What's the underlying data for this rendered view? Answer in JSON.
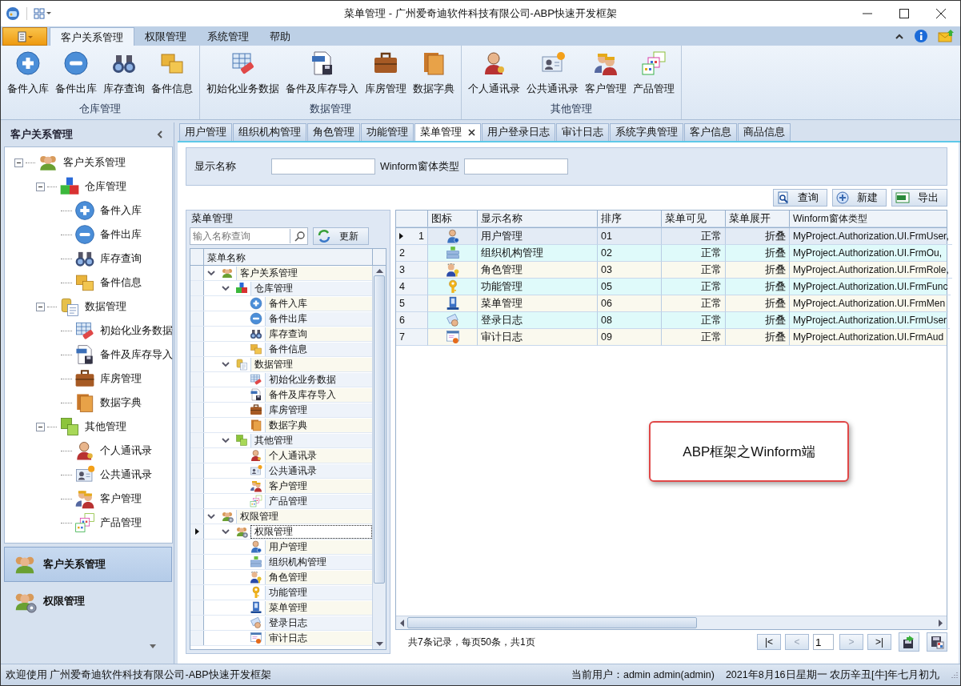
{
  "window": {
    "title": "菜单管理 - 广州爱奇迪软件科技有限公司-ABP快速开发框架"
  },
  "ribbon": {
    "tabs": [
      {
        "label": "客户关系管理",
        "selected": true
      },
      {
        "label": "权限管理",
        "selected": false
      },
      {
        "label": "系统管理",
        "selected": false
      },
      {
        "label": "帮助",
        "selected": false
      }
    ],
    "groups": [
      {
        "label": "仓库管理",
        "buttons": [
          "备件入库",
          "备件出库",
          "库存查询",
          "备件信息"
        ]
      },
      {
        "label": "数据管理",
        "buttons": [
          "初始化业务数据",
          "备件及库存导入",
          "库房管理",
          "数据字典"
        ]
      },
      {
        "label": "其他管理",
        "buttons": [
          "个人通讯录",
          "公共通讯录",
          "客户管理",
          "产品管理"
        ]
      }
    ]
  },
  "nav": {
    "title": "客户关系管理",
    "tree": [
      {
        "label": "客户关系管理",
        "expanded": true,
        "children": [
          {
            "label": "仓库管理",
            "expanded": true,
            "children": [
              {
                "label": "备件入库"
              },
              {
                "label": "备件出库"
              },
              {
                "label": "库存查询"
              },
              {
                "label": "备件信息"
              }
            ]
          },
          {
            "label": "数据管理",
            "expanded": true,
            "children": [
              {
                "label": "初始化业务数据"
              },
              {
                "label": "备件及库存导入"
              },
              {
                "label": "库房管理"
              },
              {
                "label": "数据字典"
              }
            ]
          },
          {
            "label": "其他管理",
            "expanded": true,
            "children": [
              {
                "label": "个人通讯录"
              },
              {
                "label": "公共通讯录"
              },
              {
                "label": "客户管理"
              },
              {
                "label": "产品管理"
              }
            ]
          }
        ]
      }
    ],
    "panes": [
      {
        "label": "客户关系管理",
        "selected": true
      },
      {
        "label": "权限管理",
        "selected": false
      }
    ]
  },
  "doc_tabs": [
    {
      "label": "用户管理",
      "selected": false
    },
    {
      "label": "组织机构管理",
      "selected": false
    },
    {
      "label": "角色管理",
      "selected": false
    },
    {
      "label": "功能管理",
      "selected": false
    },
    {
      "label": "菜单管理",
      "selected": true
    },
    {
      "label": "用户登录日志",
      "selected": false
    },
    {
      "label": "审计日志",
      "selected": false
    },
    {
      "label": "系统字典管理",
      "selected": false
    },
    {
      "label": "客户信息",
      "selected": false
    },
    {
      "label": "商品信息",
      "selected": false
    }
  ],
  "search_fields": [
    {
      "label": "显示名称"
    },
    {
      "label": "Winform窗体类型"
    }
  ],
  "actions": [
    "查询",
    "新建",
    "导出"
  ],
  "menu_tree": {
    "title": "菜单管理",
    "search": {
      "placeholder": "输入名称查询"
    },
    "refresh": "更新",
    "column": "菜单名称",
    "rows": [
      {
        "label": "客户关系管理",
        "selected": false,
        "expanded": true,
        "children": [
          {
            "label": "仓库管理",
            "selected": false,
            "expanded": true,
            "children": [
              {
                "label": "备件入库",
                "selected": false
              },
              {
                "label": "备件出库",
                "selected": false
              },
              {
                "label": "库存查询",
                "selected": false
              },
              {
                "label": "备件信息",
                "selected": false
              }
            ]
          },
          {
            "label": "数据管理",
            "selected": false,
            "expanded": true,
            "children": [
              {
                "label": "初始化业务数据",
                "selected": false
              },
              {
                "label": "备件及库存导入",
                "selected": false
              },
              {
                "label": "库房管理",
                "selected": false
              },
              {
                "label": "数据字典",
                "selected": false
              }
            ]
          },
          {
            "label": "其他管理",
            "selected": false,
            "expanded": true,
            "children": [
              {
                "label": "个人通讯录",
                "selected": false
              },
              {
                "label": "公共通讯录",
                "selected": false
              },
              {
                "label": "客户管理",
                "selected": false
              },
              {
                "label": "产品管理",
                "selected": false
              }
            ]
          }
        ]
      },
      {
        "label": "权限管理",
        "selected": false,
        "expanded": true,
        "children": [
          {
            "label": "权限管理",
            "selected": true,
            "expanded": true,
            "children": [
              {
                "label": "用户管理",
                "selected": false
              },
              {
                "label": "组织机构管理",
                "selected": false
              },
              {
                "label": "角色管理",
                "selected": false
              },
              {
                "label": "功能管理",
                "selected": false
              },
              {
                "label": "菜单管理",
                "selected": false
              },
              {
                "label": "登录日志",
                "selected": false
              },
              {
                "label": "审计日志",
                "selected": false
              }
            ]
          }
        ]
      }
    ]
  },
  "grid": {
    "columns": [
      "图标",
      "显示名称",
      "排序",
      "菜单可见",
      "菜单展开",
      "Winform窗体类型"
    ],
    "rows": [
      {
        "num": "1",
        "name": "用户管理",
        "sort": "01",
        "visible": "正常",
        "expand": "折叠",
        "form": "MyProject.Authorization.UI.FrmUser,",
        "selected": true
      },
      {
        "num": "2",
        "name": "组织机构管理",
        "sort": "02",
        "visible": "正常",
        "expand": "折叠",
        "form": "MyProject.Authorization.UI.FrmOu,",
        "selected": false
      },
      {
        "num": "3",
        "name": "角色管理",
        "sort": "03",
        "visible": "正常",
        "expand": "折叠",
        "form": "MyProject.Authorization.UI.FrmRole,",
        "selected": false
      },
      {
        "num": "4",
        "name": "功能管理",
        "sort": "05",
        "visible": "正常",
        "expand": "折叠",
        "form": "MyProject.Authorization.UI.FrmFunc",
        "selected": false
      },
      {
        "num": "5",
        "name": "菜单管理",
        "sort": "06",
        "visible": "正常",
        "expand": "折叠",
        "form": "MyProject.Authorization.UI.FrmMen",
        "selected": false
      },
      {
        "num": "6",
        "name": "登录日志",
        "sort": "08",
        "visible": "正常",
        "expand": "折叠",
        "form": "MyProject.Authorization.UI.FrmUser",
        "selected": false
      },
      {
        "num": "7",
        "name": "审计日志",
        "sort": "09",
        "visible": "正常",
        "expand": "折叠",
        "form": "MyProject.Authorization.UI.FrmAud",
        "selected": false
      }
    ]
  },
  "pager": {
    "summary": "共7条记录，每页50条，共1页",
    "page": "1",
    "buttons": [
      {
        "label": "|<",
        "disabled": false
      },
      {
        "label": "<",
        "disabled": true
      },
      {
        "label": ">",
        "disabled": true
      },
      {
        "label": ">|",
        "disabled": false
      }
    ]
  },
  "callout": "ABP框架之Winform端",
  "status_bar": {
    "welcome": "欢迎使用 广州爱奇迪软件科技有限公司-ABP快速开发框架",
    "user": "当前用户：admin admin(admin)",
    "date": "2021年8月16日星期一 农历辛丑[牛]年七月初九"
  }
}
